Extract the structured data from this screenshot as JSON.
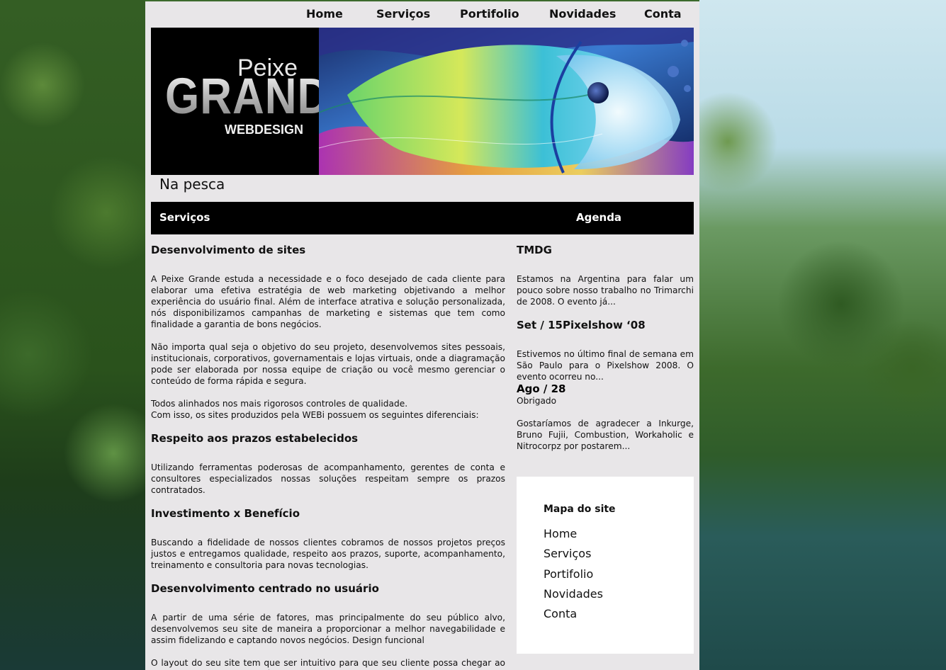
{
  "nav": {
    "items": [
      "Home",
      "Serviços",
      "Portifolio",
      "Novidades",
      "Conta"
    ]
  },
  "banner": {
    "logo_peixe": "Peixe",
    "logo_grande": "GRANDE",
    "logo_webdesign": "WEBDESIGN"
  },
  "tagline": "Na pesca",
  "section_bar": {
    "left": "Serviços",
    "right": "Agenda"
  },
  "main": {
    "h1": "Desenvolvimento de sites",
    "p1": "A Peixe Grande estuda a necessidade e o foco desejado de cada cliente para elaborar uma efetiva estratégia de web marketing objetivando a melhor experiência do usuário final. Além de interface atrativa e solução personalizada, nós disponibilizamos campanhas de marketing e sistemas que tem como finalidade a garantia de bons negócios.",
    "p2": "Não importa qual seja o objetivo do seu projeto, desenvolvemos sites pessoais, institucionais, corporativos, governamentais e lojas virtuais, onde a diagramação pode ser elaborada por nossa equipe de criação ou você mesmo gerenciar o conteúdo de forma rápida e segura.",
    "p3a": "Todos alinhados nos mais rigorosos controles de qualidade.",
    "p3b": "Com isso, os sites produzidos pela WEBi possuem os seguintes diferenciais:",
    "h2": "Respeito aos prazos estabelecidos",
    "p4": "Utilizando ferramentas poderosas de acompanhamento, gerentes de conta e consultores especializados nossas soluções respeitam sempre os prazos contratados.",
    "h3": "Investimento x Benefício",
    "p5": "Buscando a fidelidade de nossos clientes cobramos de nossos projetos preços justos e entregamos qualidade, respeito aos prazos, suporte, acompanhamento, treinamento e consultoria para novas tecnologias.",
    "h4": "Desenvolvimento centrado no usuário",
    "p6": "A partir de uma série de fatores, mas principalmente do seu público alvo, desenvolvemos seu site de maneira a proporcionar a melhor navegabilidade e assim fidelizando e captando novos negócios. Design funcional",
    "p7": "O layout do seu site tem que ser intuitivo para que seu cliente possa chegar ao resultado final de forma rápida e sem dispersão. Um design funcional auxilia a navegação e a conquista do usuário final."
  },
  "agenda": {
    "t1": "TMDG",
    "e1": "Estamos na Argentina para falar um pouco sobre nosso trabalho no Trimarchi de 2008. O evento já...",
    "t2": "Set / 15Pixelshow ‘08",
    "e2": "Estivemos no último final de semana em São Paulo para o Pixelshow 2008. O evento ocorreu no...",
    "t3": "Ago / 28",
    "e3a": "Obrigado",
    "e3b": "Gostaríamos de agradecer a Inkurge, Bruno Fujii, Combustion, Workaholic e Nitrocorpz por postarem..."
  },
  "sitemap": {
    "title": "Mapa do site",
    "links": [
      "Home",
      "Serviços",
      "Portifolio",
      "Novidades",
      "Conta"
    ]
  }
}
